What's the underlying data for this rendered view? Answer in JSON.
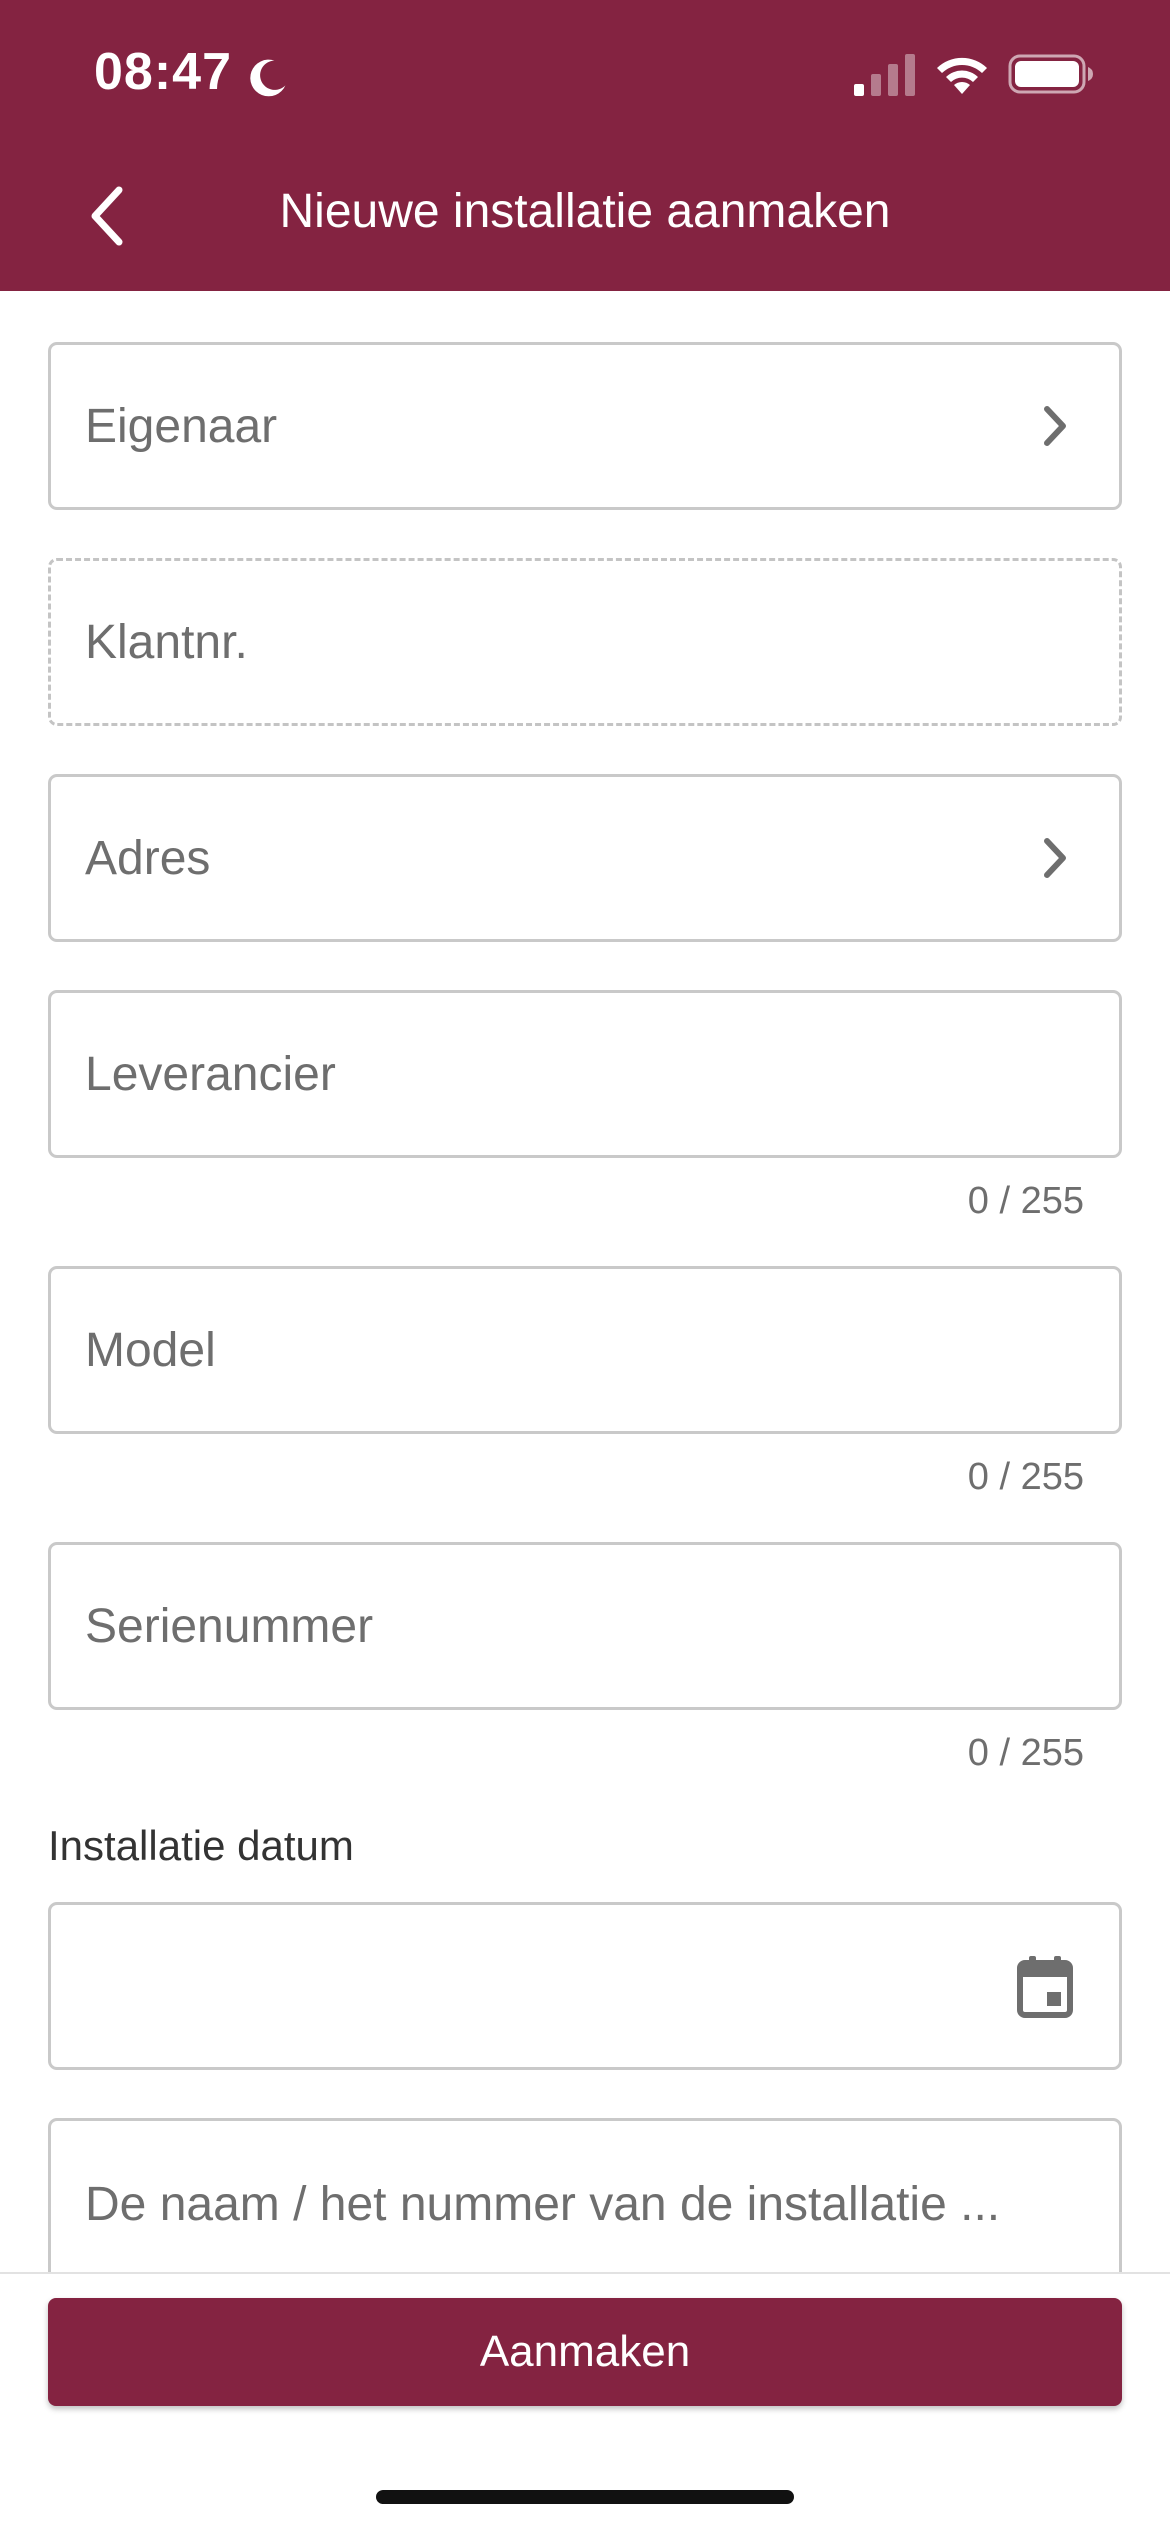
{
  "status_bar": {
    "time": "08:47"
  },
  "header": {
    "title": "Nieuwe installatie aanmaken",
    "color": "#842341"
  },
  "form": {
    "owner_label": "Eigenaar",
    "customer_number_label": "Klantnr.",
    "address_label": "Adres",
    "supplier_label": "Leverancier",
    "supplier_counter": "0 / 255",
    "model_label": "Model",
    "model_counter": "0 / 255",
    "serial_label": "Serienummer",
    "serial_counter": "0 / 255",
    "install_date_label": "Installatie datum",
    "install_date_value": "",
    "installation_name_placeholder": "De naam / het nummer van de installatie ..."
  },
  "actions": {
    "create_label": "Aanmaken"
  },
  "icons": [
    "moon-icon",
    "signal-icon",
    "wifi-icon",
    "battery-icon",
    "back-arrow-icon",
    "chevron-right-icon",
    "calendar-icon"
  ]
}
